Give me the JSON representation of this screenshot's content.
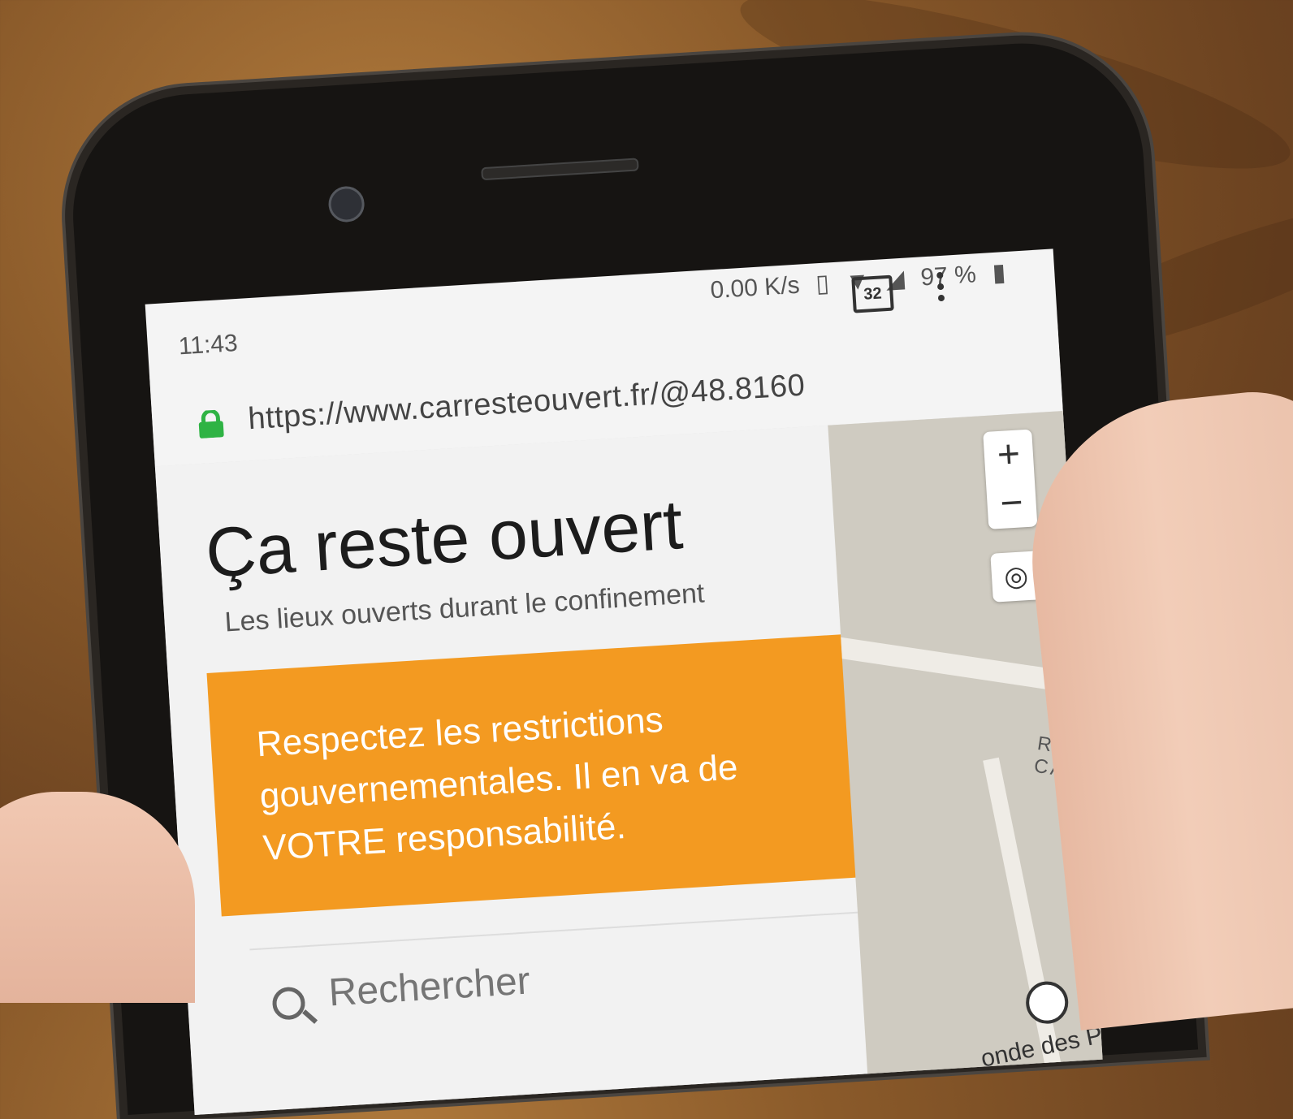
{
  "status_bar": {
    "time": "11:43",
    "network_speed": "0.00 K/s",
    "battery": "97 %"
  },
  "browser": {
    "url": "https://www.carresteouvert.fr/@48.8160",
    "tab_count": "32"
  },
  "page": {
    "title": "Ça reste ouvert",
    "subtitle": "Les lieux ouverts durant le confinement",
    "banner_text": "Respectez les restrictions gouvernementales. Il en va de VOTRE responsabilité.",
    "search_placeholder": "Rechercher"
  },
  "map": {
    "zoom_in": "+",
    "zoom_out": "−",
    "street_label": "RUE CA",
    "place_label": "onde des Pains"
  },
  "colors": {
    "banner": "#f39a21",
    "checkbox": "#1a6be6",
    "lock": "#2fb344"
  }
}
